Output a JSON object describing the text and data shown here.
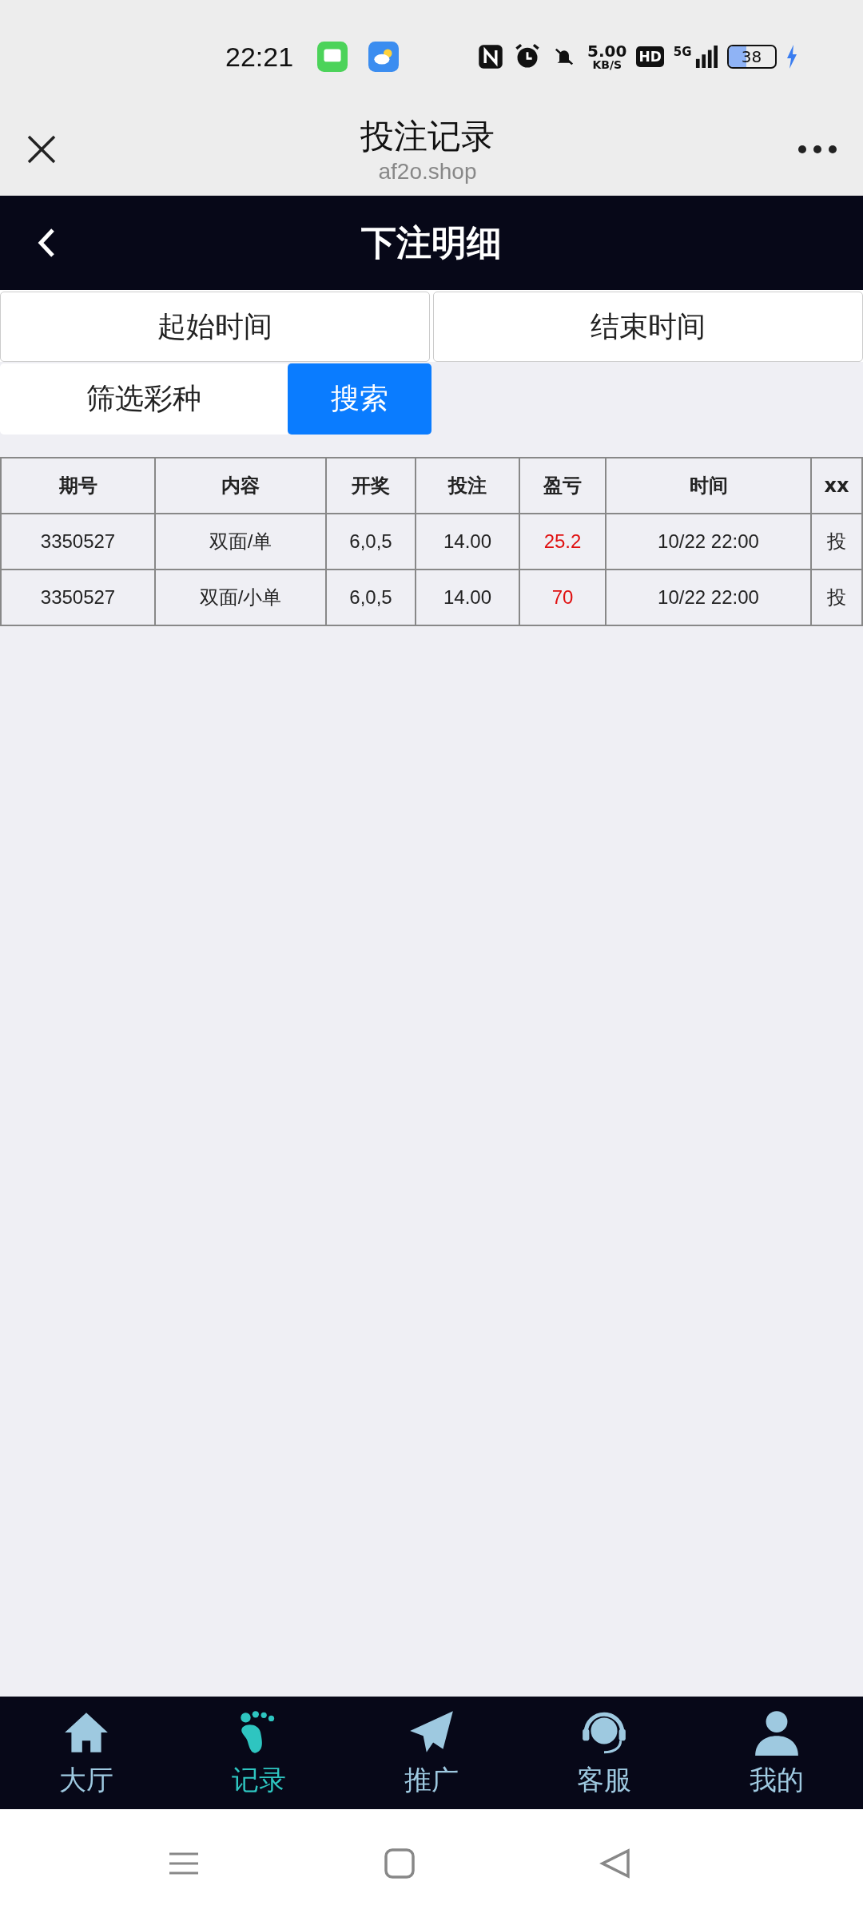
{
  "status_bar": {
    "time": "22:21",
    "net_speed": "5.00",
    "net_unit": "KB/S",
    "hd": "HD",
    "network": "5G",
    "battery": "38"
  },
  "browser_bar": {
    "title": "投注记录",
    "url": "af2o.shop"
  },
  "header": {
    "title": "下注明细"
  },
  "date_buttons": [
    {
      "label": "起始时间"
    },
    {
      "label": "结束时间"
    }
  ],
  "filter": {
    "label": "筛选彩种",
    "search": "搜索"
  },
  "table": {
    "columns": [
      "期号",
      "内容",
      "开奖",
      "投注",
      "盈亏",
      "时间",
      "xx"
    ],
    "rows": [
      [
        "3350527",
        "双面/单",
        "6,0,5",
        "14.00",
        "25.2",
        "10/22 22:00",
        "投"
      ],
      [
        "3350527",
        "双面/小单",
        "6,0,5",
        "14.00",
        "70",
        "10/22 22:00",
        "投"
      ]
    ]
  },
  "tabbar": [
    {
      "label": "大厅",
      "selected": false
    },
    {
      "label": "记录",
      "selected": true
    },
    {
      "label": "推广",
      "selected": false
    },
    {
      "label": "客服",
      "selected": false
    },
    {
      "label": "我的",
      "selected": false
    }
  ]
}
